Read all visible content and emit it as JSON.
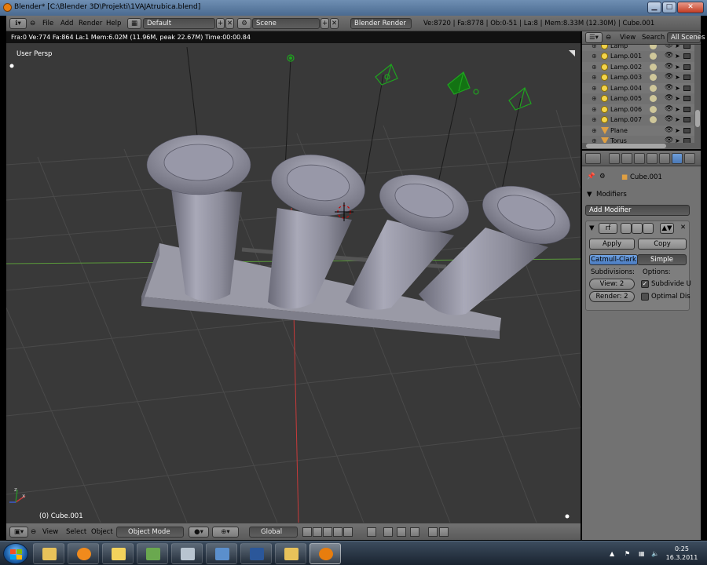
{
  "window": {
    "title": "Blender* [C:\\Blender 3D\\Projekti\\1VAJAtrubica.blend]",
    "minimize": "▁",
    "maximize": "□",
    "close": "✕"
  },
  "info_header": {
    "menus": [
      "File",
      "Add",
      "Render",
      "Help"
    ],
    "screen_layout": "Default",
    "scene": "Scene",
    "render_engine": "Blender Render",
    "stats": "Ve:8720 | Fa:8778 | Ob:0-51 | La:8 | Mem:8.33M (12.30M) | Cube.001"
  },
  "viewport": {
    "status": "Fra:0  Ve:774 Fa:864 La:1 Mem:6.02M (11.96M, peak 22.67M) Time:00:00.84",
    "view_name": "User Persp",
    "active_object": "(0) Cube.001",
    "axis_x_label": "x",
    "axis_z_label": "z"
  },
  "viewport_header": {
    "menus": [
      "View",
      "Select",
      "Object"
    ],
    "mode": "Object Mode",
    "orientation": "Global"
  },
  "outliner": {
    "header": {
      "view": "View",
      "search": "Search",
      "filter": "All Scenes"
    },
    "rows": [
      {
        "label": "Lamp",
        "type": "lamp"
      },
      {
        "label": "Lamp.001",
        "type": "lamp"
      },
      {
        "label": "Lamp.002",
        "type": "lamp"
      },
      {
        "label": "Lamp.003",
        "type": "lamp"
      },
      {
        "label": "Lamp.004",
        "type": "lamp"
      },
      {
        "label": "Lamp.005",
        "type": "lamp"
      },
      {
        "label": "Lamp.006",
        "type": "lamp"
      },
      {
        "label": "Lamp.007",
        "type": "lamp"
      },
      {
        "label": "Plane",
        "type": "mesh"
      },
      {
        "label": "Torus",
        "type": "mesh"
      }
    ]
  },
  "properties": {
    "context_object": "Cube.001",
    "panel_title": "Modifiers",
    "add_modifier": "Add Modifier",
    "modifier": {
      "apply": "Apply",
      "copy": "Copy",
      "type_catmull": "Catmull-Clark",
      "type_simple": "Simple",
      "subdivisions_label": "Subdivisions:",
      "options_label": "Options:",
      "view_levels": "View: 2",
      "render_levels": "Render: 2",
      "subdivide_uvs": "Subdivide U",
      "optimal_display": "Optimal Dis",
      "subdivide_uvs_checked": true,
      "optimal_display_checked": false
    }
  },
  "taskbar": {
    "time": "0:25",
    "date": "16.3.2011"
  },
  "colors": {
    "viewport_bg": "#393939",
    "grid": "#4a4a4a",
    "axis_x": "#c83a3a",
    "axis_y": "#5a9a3a",
    "lamp_green": "#1fa31f",
    "mesh": "#8f8f9c",
    "selection_blue": "#5a8fd0"
  }
}
